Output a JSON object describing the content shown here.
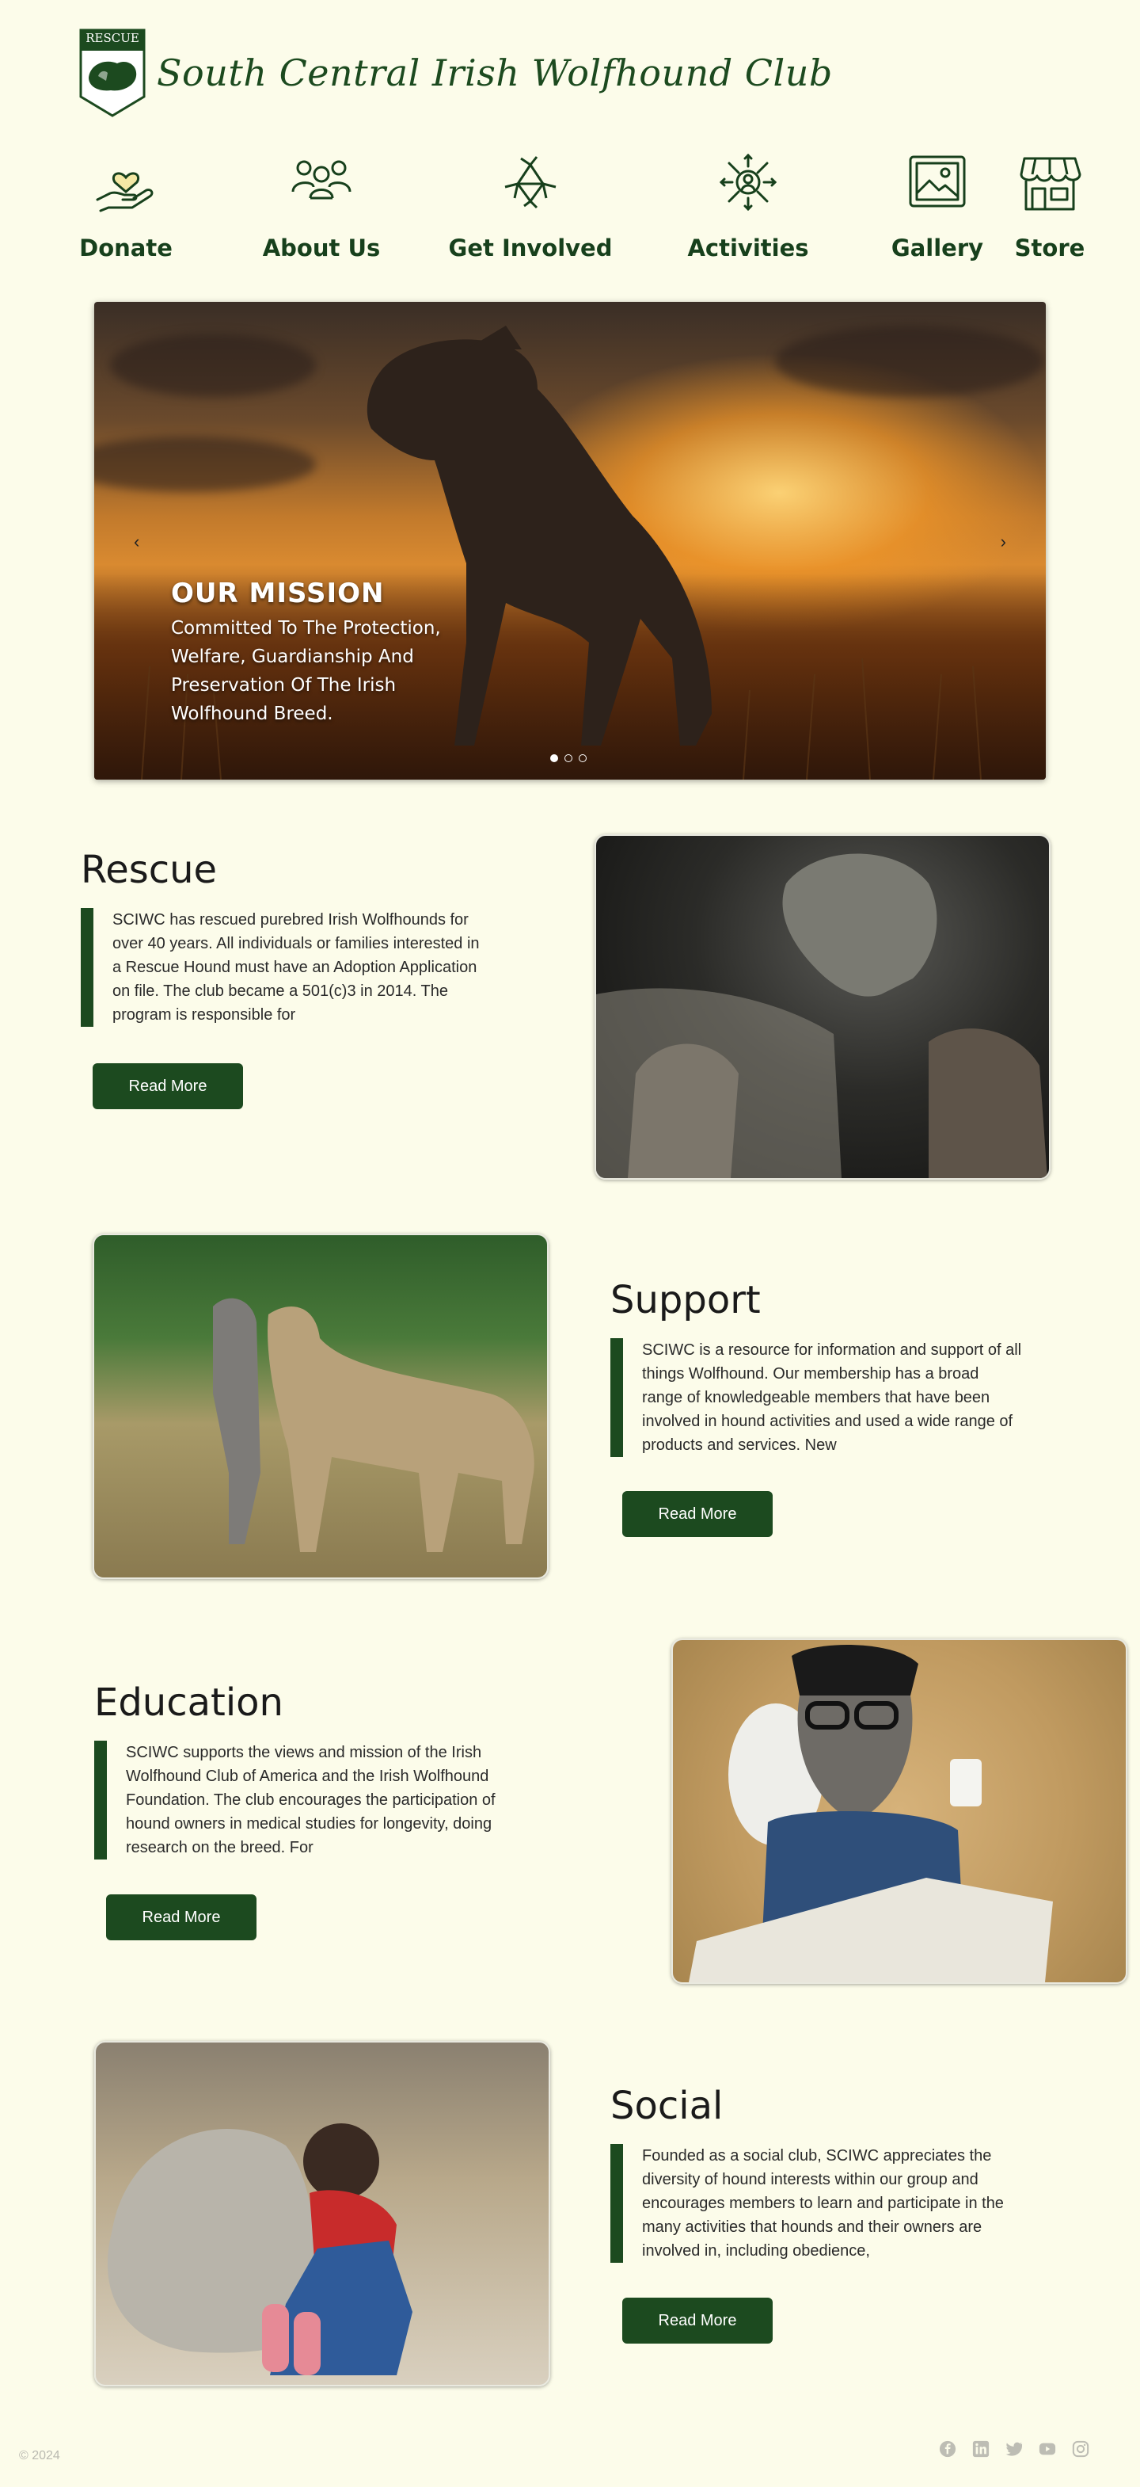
{
  "header": {
    "logo_text": "RESCUE",
    "site_title": "South Central Irish Wolfhound Club"
  },
  "nav": [
    {
      "label": "Donate",
      "icon": "donate-heart-hand-icon"
    },
    {
      "label": "About Us",
      "icon": "people-group-icon"
    },
    {
      "label": "Get Involved",
      "icon": "joined-hands-icon"
    },
    {
      "label": "Activities",
      "icon": "network-person-icon"
    },
    {
      "label": "Gallery",
      "icon": "picture-frame-icon"
    },
    {
      "label": "Store",
      "icon": "storefront-icon"
    }
  ],
  "hero": {
    "title": "OUR MISSION",
    "subtitle": "Committed To The Protection, Welfare, Guardianship And Preservation Of The Irish Wolfhound Breed.",
    "prev": "‹",
    "next": "›",
    "slide_count": 3,
    "active_slide": 1
  },
  "sections": [
    {
      "title": "Rescue",
      "body": "SCIWC has rescued purebred Irish Wolfhounds for over 40 years. All individuals or families interested in a Rescue Hound must have an Adoption Application on file. The club became a 501(c)3 in 2014. The program is responsible for",
      "button": "Read More"
    },
    {
      "title": "Support",
      "body": "SCIWC is a resource for information and support of all things Wolfhound. Our membership has a broad range of knowledgeable members that have been involved in hound activities and used a wide range of products and services. New",
      "button": "Read More"
    },
    {
      "title": "Education",
      "body": "SCIWC supports the views and mission of the Irish Wolfhound Club of America and the Irish Wolfhound Foundation. The club encourages the participation of hound owners in  medical studies for longevity, doing research on the breed. For",
      "button": "Read More"
    },
    {
      "title": "Social",
      "body": "Founded as a social club, SCIWC appreciates the diversity of hound interests within our group and encourages members to learn and participate in the many activities that hounds and their owners are involved in, including obedience,",
      "button": "Read More"
    }
  ],
  "footer": {
    "copyright": "© 2024",
    "socials": [
      "facebook-icon",
      "linkedin-icon",
      "twitter-icon",
      "youtube-icon",
      "instagram-icon"
    ]
  },
  "colors": {
    "background": "#fcfcea",
    "brand_green": "#1c4a1f"
  }
}
